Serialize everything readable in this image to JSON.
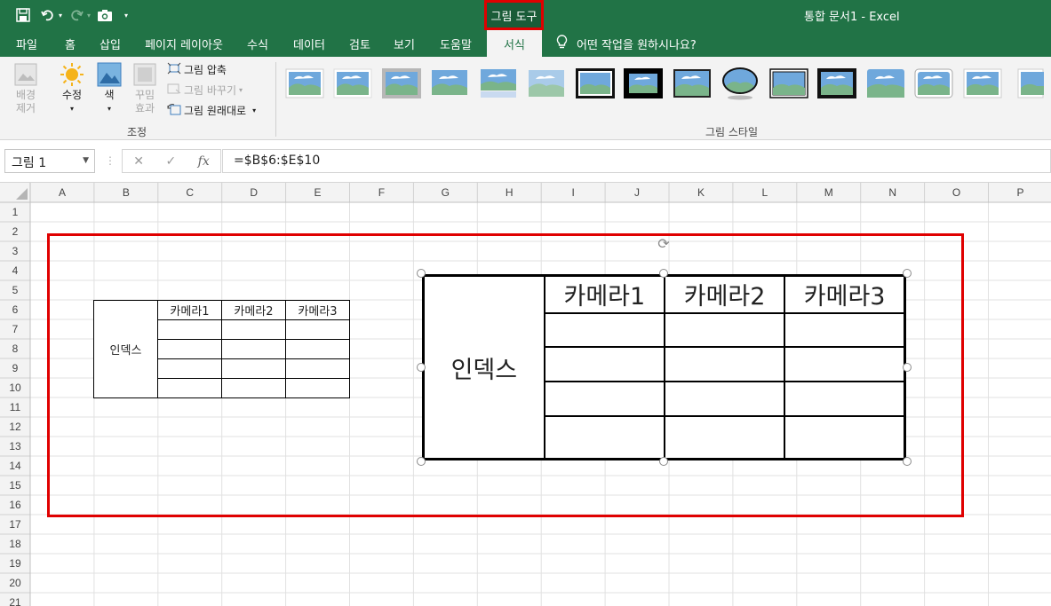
{
  "titlebar": {
    "tools_label": "그림 도구",
    "doc_title": "통합 문서1  -  Excel",
    "accent": "#217346"
  },
  "quick_access": [
    "save-icon",
    "undo-icon",
    "redo-icon",
    "camera-icon",
    "customize-icon"
  ],
  "tabs": [
    {
      "label": "파일"
    },
    {
      "label": "홈"
    },
    {
      "label": "삽입"
    },
    {
      "label": "페이지 레이아웃"
    },
    {
      "label": "수식"
    },
    {
      "label": "데이터"
    },
    {
      "label": "검토"
    },
    {
      "label": "보기"
    },
    {
      "label": "도움말"
    },
    {
      "label": "서식"
    }
  ],
  "tell_me": "어떤 작업을 원하시나요?",
  "ribbon": {
    "remove_bg": "배경\n제거",
    "corrections": "수정",
    "color": "색",
    "artistic": "꾸밈\n효과",
    "compress": "그림 압축",
    "change": "그림 바꾸기",
    "reset": "그림 원래대로",
    "adjust_group": "조정",
    "styles_group": "그림 스타일"
  },
  "formula_bar": {
    "name_box": "그림 1",
    "cancel": "✕",
    "enter": "✓",
    "fx": "fx",
    "formula": "=$B$6:$E$10"
  },
  "columns": [
    "A",
    "B",
    "C",
    "D",
    "E",
    "F",
    "G",
    "H",
    "I",
    "J",
    "K",
    "L",
    "M",
    "N",
    "O",
    "P"
  ],
  "rows": [
    "1",
    "2",
    "3",
    "4",
    "5",
    "6",
    "7",
    "8",
    "9",
    "10",
    "11",
    "12",
    "13",
    "14",
    "15",
    "16",
    "17",
    "18",
    "19",
    "20",
    "21"
  ],
  "small_table": {
    "index": "인덱스",
    "headers": [
      "카메라1",
      "카메라2",
      "카메라3"
    ]
  },
  "picture_table": {
    "index": "인덱스",
    "headers": [
      "카메라1",
      "카메라2",
      "카메라3"
    ]
  }
}
